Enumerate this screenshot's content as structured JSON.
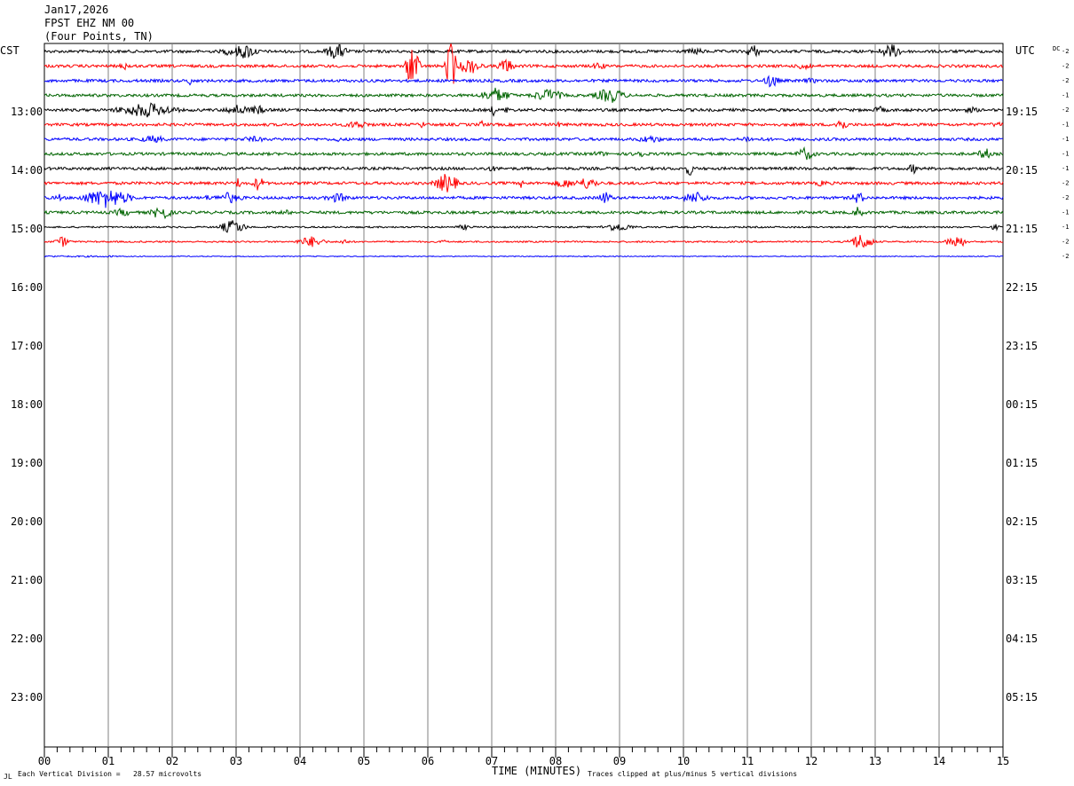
{
  "header": {
    "date": "Jan17,2026",
    "station": "FPST EHZ NM 00",
    "location": "(Four Points, TN)"
  },
  "left_tz": "CST",
  "right_tz": "UTC",
  "dc_label": "DC",
  "footer": {
    "division": "Each Vertical Division =   28.57 microvolts",
    "xtitle": "TIME (MINUTES)",
    "clip": "Traces clipped at plus/minus 5 vertical divisions",
    "mark": "JL"
  },
  "colors": {
    "black": "#000000",
    "red": "#ff0000",
    "blue": "#0000ff",
    "green": "#006400",
    "grid": "#808080"
  },
  "chart_data": {
    "type": "line",
    "title": "FPST EHZ NM 00 (Four Points, TN)",
    "xlabel": "TIME (MINUTES)",
    "x_ticks": [
      "00",
      "01",
      "02",
      "03",
      "04",
      "05",
      "06",
      "07",
      "08",
      "09",
      "10",
      "11",
      "12",
      "13",
      "14",
      "15"
    ],
    "xlim": [
      0,
      15
    ],
    "left_hours": [
      "13:00",
      "14:00",
      "15:00",
      "16:00",
      "17:00",
      "18:00",
      "19:00",
      "20:00",
      "21:00",
      "22:00",
      "23:00"
    ],
    "right_hours": [
      "19:15",
      "20:15",
      "21:15",
      "22:15",
      "23:15",
      "00:15",
      "01:15",
      "02:15",
      "03:15",
      "04:15",
      "05:15"
    ],
    "trace_color_cycle": [
      "black",
      "red",
      "blue",
      "green"
    ],
    "traces_drawn": 15,
    "dc_offsets": [
      "-2",
      "-2",
      "-2",
      "-1",
      "-2",
      "-1",
      "-1",
      "-1",
      "-1",
      "-2",
      "-2",
      "-1",
      "-1",
      "-2",
      "-2"
    ]
  }
}
